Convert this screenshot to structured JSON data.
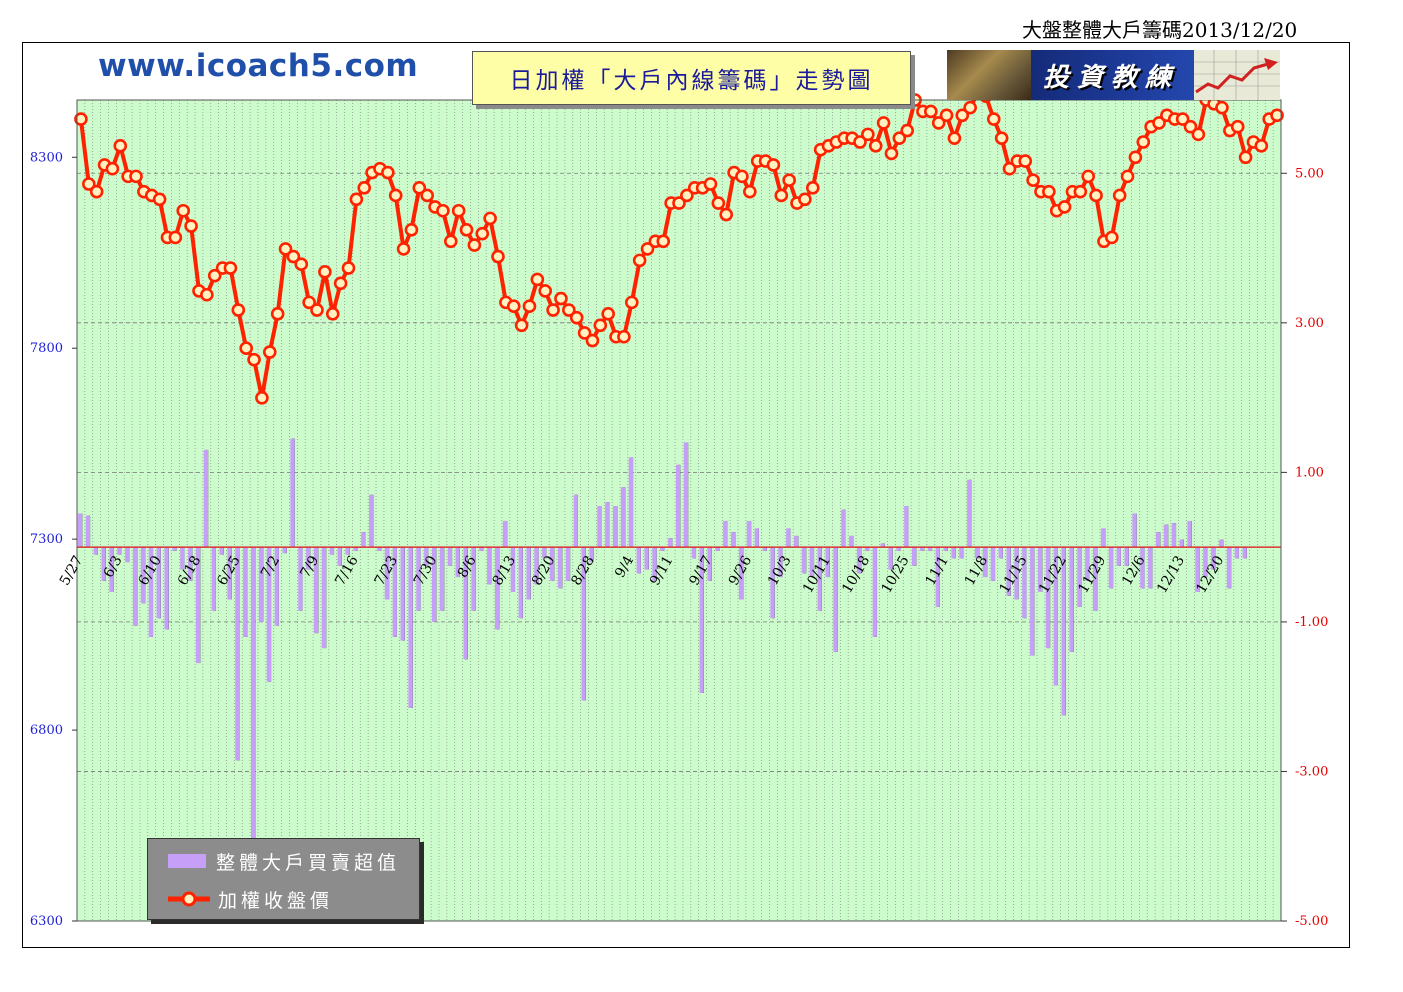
{
  "page_title": "大盤整體大戶籌碼2013/12/20",
  "site_url": "www.icoach5.com",
  "chart_title": "日加權「大戶內線籌碼」走勢圖",
  "logo_text": "投資教練",
  "legend": {
    "bar_label": "整體大戶買賣超值",
    "line_label": "加權收盤價"
  },
  "colors": {
    "plot_bg": "#ccfccc",
    "bar": "#c6a0f8",
    "line": "#ff2200",
    "marker_fill": "#fff2c0",
    "left_axis": "#1f1fd6",
    "right_axis": "#e60000"
  },
  "chart_data": {
    "type": "bar+line",
    "y_left": {
      "min": 6300,
      "max": 8450,
      "ticks": [
        6300,
        6800,
        7300,
        7800,
        8300
      ]
    },
    "y_right": {
      "min": -5,
      "max": 5.98,
      "ticks": [
        "5.00",
        "3.00",
        "1.00",
        "-1.00",
        "-3.00",
        "-5.00"
      ]
    },
    "x_tick_labels": [
      "5/27",
      "6/3",
      "6/10",
      "6/18",
      "6/25",
      "7/2",
      "7/9",
      "7/16",
      "7/23",
      "7/30",
      "8/6",
      "8/13",
      "8/20",
      "8/28",
      "9/4",
      "9/11",
      "9/17",
      "9/26",
      "10/3",
      "10/11",
      "10/18",
      "10/25",
      "11/1",
      "11/8",
      "11/15",
      "11/22",
      "11/29",
      "12/6",
      "12/13",
      "12/20"
    ],
    "x_tick_label_positions": [
      0,
      5,
      10,
      15,
      20,
      25,
      30,
      35,
      40,
      45,
      50,
      55,
      60,
      65,
      70,
      75,
      80,
      85,
      90,
      95,
      100,
      105,
      110,
      115,
      120,
      125,
      130,
      135,
      140,
      145
    ],
    "close": [
      8400,
      8230,
      8210,
      8280,
      8270,
      8330,
      8250,
      8250,
      8210,
      8200,
      8190,
      8090,
      8090,
      8160,
      8120,
      7950,
      7940,
      7990,
      8010,
      8010,
      7900,
      7800,
      7770,
      7670,
      7790,
      7890,
      8060,
      8040,
      8020,
      7920,
      7900,
      8000,
      7890,
      7970,
      8010,
      8190,
      8220,
      8260,
      8270,
      8260,
      8200,
      8060,
      8110,
      8220,
      8200,
      8170,
      8160,
      8080,
      8160,
      8110,
      8070,
      8100,
      8140,
      8040,
      7920,
      7910,
      7860,
      7910,
      7980,
      7950,
      7900,
      7930,
      7900,
      7880,
      7840,
      7820,
      7860,
      7890,
      7830,
      7830,
      7920,
      8030,
      8060,
      8080,
      8080,
      8180,
      8180,
      8200,
      8220,
      8220,
      8230,
      8180,
      8150,
      8260,
      8250,
      8210,
      8290,
      8290,
      8280,
      8200,
      8240,
      8180,
      8190,
      8220,
      8320,
      8330,
      8340,
      8350,
      8350,
      8340,
      8360,
      8330,
      8390,
      8310,
      8350,
      8370,
      8450,
      8420,
      8420,
      8390,
      8410,
      8350,
      8410,
      8430,
      8470,
      8460,
      8400,
      8350,
      8270,
      8290,
      8290,
      8240,
      8210,
      8210,
      8160,
      8170,
      8210,
      8210,
      8250,
      8200,
      8080,
      8090,
      8200,
      8250,
      8300,
      8340,
      8380,
      8390,
      8410,
      8400,
      8400,
      8380,
      8360,
      8450,
      8440,
      8430,
      8370,
      8380,
      8300,
      8340,
      8330,
      8400,
      8410
    ],
    "net_buy": [
      0.45,
      0.42,
      -0.1,
      -0.45,
      -0.6,
      -0.1,
      -0.2,
      -1.05,
      -0.75,
      -1.2,
      -0.95,
      -1.1,
      -0.05,
      -0.3,
      -0.45,
      -1.55,
      1.3,
      -0.85,
      -0.1,
      -0.7,
      -2.85,
      -1.2,
      -5.0,
      -1.0,
      -1.8,
      -1.05,
      -0.08,
      1.45,
      -0.85,
      -0.3,
      -1.15,
      -1.35,
      -0.1,
      -0.25,
      -0.1,
      -0.05,
      0.2,
      0.7,
      -0.05,
      -0.7,
      -1.2,
      -1.25,
      -2.15,
      -0.85,
      -0.25,
      -1.0,
      -0.85,
      -0.25,
      -0.4,
      -1.5,
      -0.85,
      -0.05,
      -0.5,
      -1.1,
      0.35,
      -0.6,
      -0.95,
      -0.7,
      -0.5,
      -0.15,
      -0.45,
      -0.55,
      -0.45,
      0.7,
      -2.05,
      -0.2,
      0.55,
      0.6,
      0.55,
      0.8,
      1.2,
      -0.35,
      -0.3,
      -0.45,
      -0.05,
      0.12,
      1.1,
      1.4,
      -0.15,
      -1.95,
      -0.45,
      -0.05,
      0.35,
      0.2,
      -0.7,
      0.35,
      0.25,
      -0.05,
      -0.95,
      -0.4,
      0.25,
      0.15,
      -0.35,
      -0.4,
      -0.85,
      -0.4,
      -1.4,
      0.5,
      0.15,
      -0.35,
      -0.05,
      -1.2,
      0.05,
      -0.3,
      -0.05,
      0.55,
      -0.25,
      -0.05,
      -0.05,
      -0.8,
      -0.05,
      -0.15,
      -0.15,
      0.9,
      -0.15,
      -0.4,
      -0.45,
      -0.15,
      -0.65,
      -0.7,
      -0.95,
      -1.45,
      -0.6,
      -1.35,
      -1.85,
      -2.25,
      -1.4,
      -0.8,
      -0.45,
      -0.85,
      0.25,
      -0.55,
      -0.25,
      -0.25,
      0.45,
      -0.55,
      -0.55,
      0.2,
      0.3,
      0.32,
      0.1,
      0.35,
      -0.6,
      -0.4,
      -0.3,
      0.1,
      -0.55,
      -0.15,
      -0.15
    ]
  }
}
